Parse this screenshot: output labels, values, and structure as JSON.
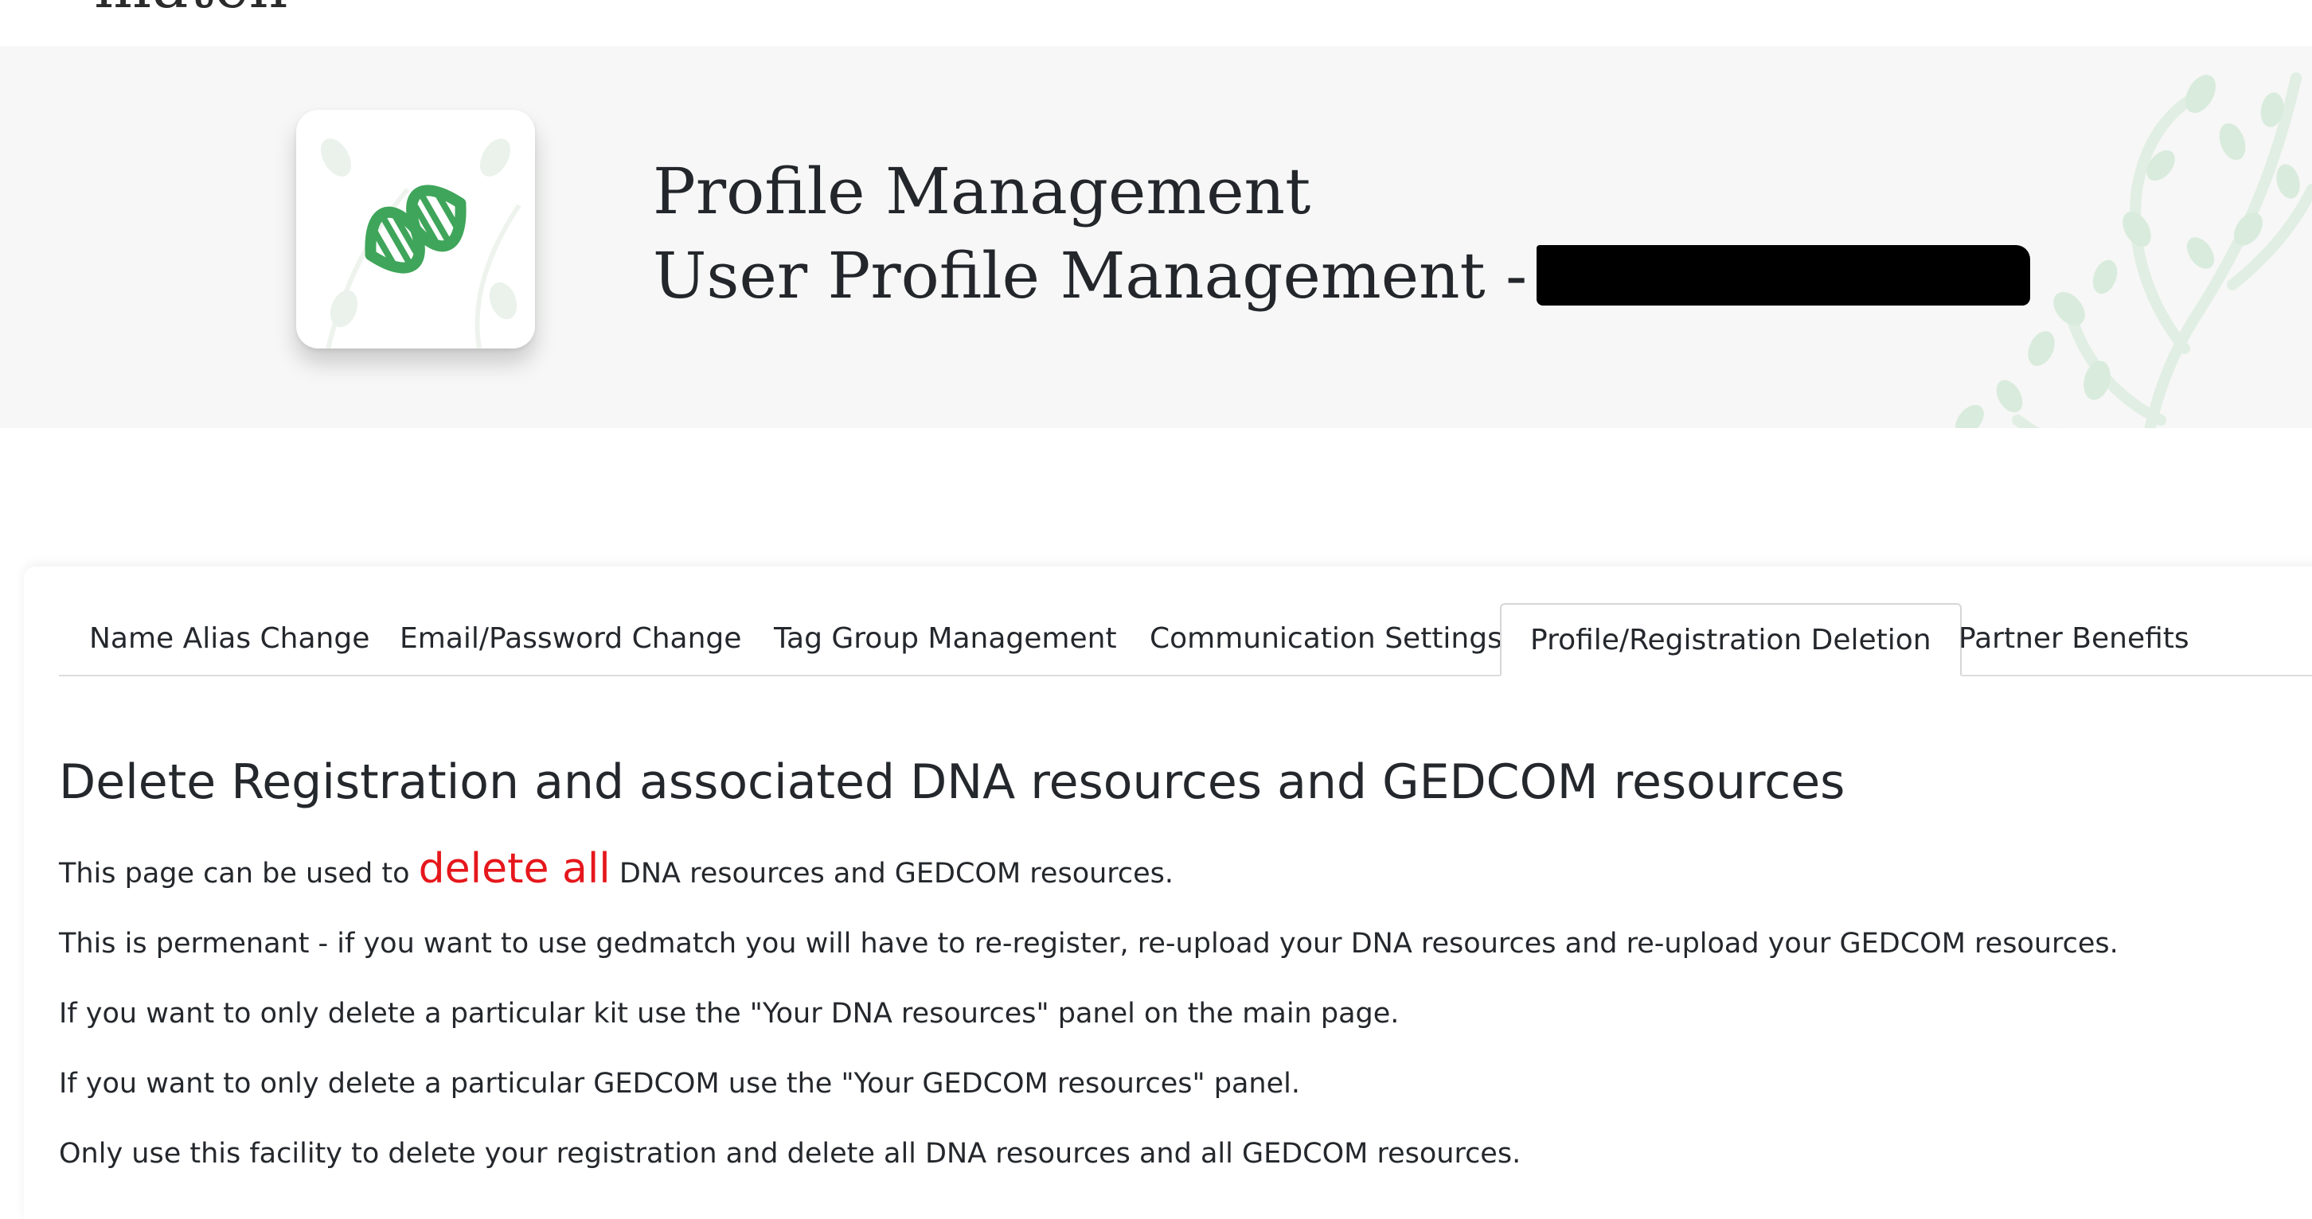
{
  "header": {
    "logo_fragment": "match"
  },
  "hero": {
    "icon": "dna-helix-icon",
    "title_line1": "Profile Management",
    "title_line2": "User Profile Management -"
  },
  "tabs": [
    {
      "label": "Name Alias Change",
      "active": false
    },
    {
      "label": "Email/Password Change",
      "active": false
    },
    {
      "label": "Tag Group Management",
      "active": false
    },
    {
      "label": "Communication Settings",
      "active": false
    },
    {
      "label": "Profile/Registration Deletion",
      "active": true
    },
    {
      "label": "Partner Benefits",
      "active": false
    }
  ],
  "content": {
    "heading": "Delete Registration and associated DNA resources and GEDCOM resources",
    "intro_before": "This page can be used to",
    "intro_emphasis": "delete all",
    "intro_after": "DNA resources and GEDCOM resources.",
    "paragraphs": [
      "This is permenant - if you want to use gedmatch you will have to re-register, re-upload your DNA resources and re-upload your GEDCOM resources.",
      "If you want to only delete a particular kit use the \"Your DNA resources\" panel on the main page.",
      "If you want to only delete a particular GEDCOM use the \"Your GEDCOM resources\" panel.",
      "Only use this facility to delete your registration and delete all DNA resources and all GEDCOM resources."
    ]
  },
  "colors": {
    "accent_green": "#3fa55a",
    "emphasis_red": "#e5171b",
    "banner_bg": "#f6f7f6",
    "tree_leaf": "#cfe6d2"
  }
}
